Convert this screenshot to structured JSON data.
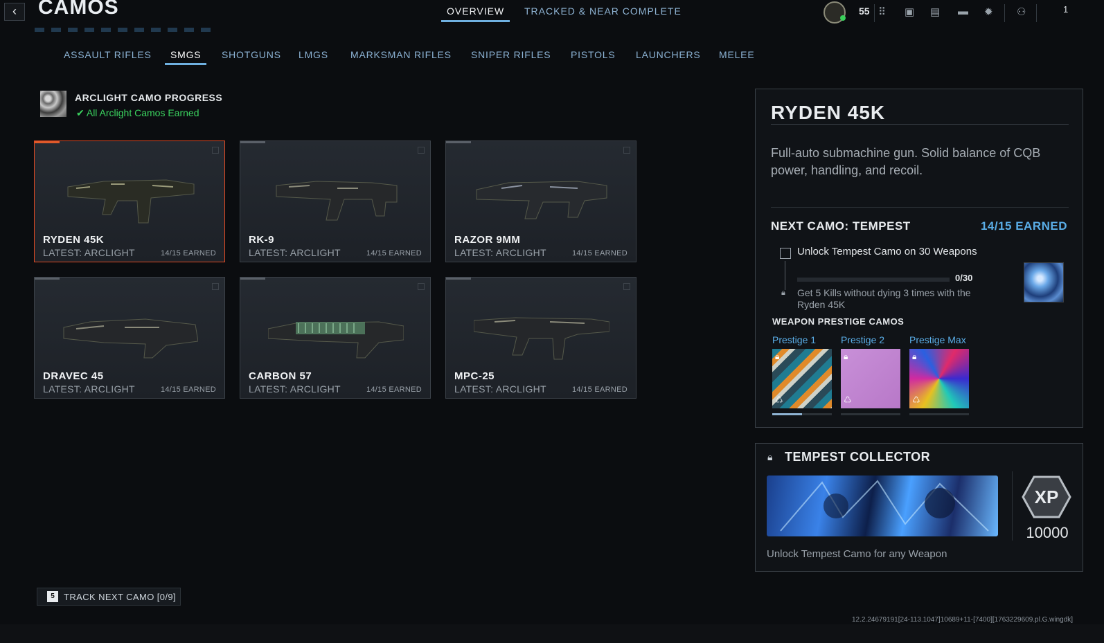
{
  "header": {
    "back_glyph": "‹",
    "title": "CAMOS",
    "tabs": [
      {
        "label": "OVERVIEW",
        "active": true
      },
      {
        "label": "TRACKED & NEAR COMPLETE",
        "active": false
      }
    ],
    "rank_level": "55",
    "players_count": "1",
    "icons": [
      "grid-menu-icon",
      "bookmark-icon",
      "map-icon",
      "chat-icon",
      "settings-gear-icon",
      "party-icon"
    ]
  },
  "categories": [
    {
      "label": "ASSAULT RIFLES",
      "active": false
    },
    {
      "label": "SMGS",
      "active": true
    },
    {
      "label": "SHOTGUNS",
      "active": false
    },
    {
      "label": "LMGS",
      "active": false
    },
    {
      "label": "MARKSMAN RIFLES",
      "active": false
    },
    {
      "label": "SNIPER RIFLES",
      "active": false
    },
    {
      "label": "PISTOLS",
      "active": false
    },
    {
      "label": "LAUNCHERS",
      "active": false
    },
    {
      "label": "MELEE",
      "active": false
    }
  ],
  "arclight": {
    "title": "ARCLIGHT CAMO PROGRESS",
    "status": "All Arclight Camos Earned",
    "status_color": "#3bd35f"
  },
  "weapons": [
    {
      "name": "RYDEN 45K",
      "latest": "LATEST: ARCLIGHT",
      "earned": "14/15 EARNED",
      "selected": true
    },
    {
      "name": "RK-9",
      "latest": "LATEST: ARCLIGHT",
      "earned": "14/15 EARNED",
      "selected": false
    },
    {
      "name": "RAZOR 9MM",
      "latest": "LATEST: ARCLIGHT",
      "earned": "14/15 EARNED",
      "selected": false
    },
    {
      "name": "DRAVEC 45",
      "latest": "LATEST: ARCLIGHT",
      "earned": "14/15 EARNED",
      "selected": false
    },
    {
      "name": "CARBON 57",
      "latest": "LATEST: ARCLIGHT",
      "earned": "14/15 EARNED",
      "selected": false
    },
    {
      "name": "MPC-25",
      "latest": "LATEST: ARCLIGHT",
      "earned": "14/15 EARNED",
      "selected": false
    }
  ],
  "detail": {
    "title": "RYDEN 45K",
    "description": "Full-auto submachine gun. Solid balance of CQB power, handling, and recoil.",
    "next_camo_label": "NEXT CAMO: TEMPEST",
    "next_camo_count": "14/15 EARNED",
    "challenge_title": "Unlock Tempest Camo on 30 Weapons",
    "challenge_progress": "0/30",
    "challenge_progress_fraction": 0,
    "challenge_sub": "Get 5 Kills without dying 3 times with the Ryden 45K",
    "prestige_heading": "WEAPON PRESTIGE CAMOS",
    "prestige": [
      {
        "label": "Prestige 1",
        "progress_fraction": 0.5
      },
      {
        "label": "Prestige 2",
        "progress_fraction": 0
      },
      {
        "label": "Prestige Max",
        "progress_fraction": 0
      }
    ]
  },
  "tempest_collector": {
    "title": "TEMPEST COLLECTOR",
    "xp_label": "XP",
    "xp_amount": "10000",
    "description": "Unlock Tempest Camo for any Weapon"
  },
  "footer": {
    "track_key": "5",
    "track_label": "TRACK NEXT CAMO [0/9]",
    "build_info": "12.2.24679191[24-113.1047]10689+11-[7400][1763229609.pl.G.wingdk]"
  },
  "colors": {
    "accent_blue": "#5aaee8",
    "selected_border": "#e04a23",
    "success_green": "#3bd35f"
  }
}
